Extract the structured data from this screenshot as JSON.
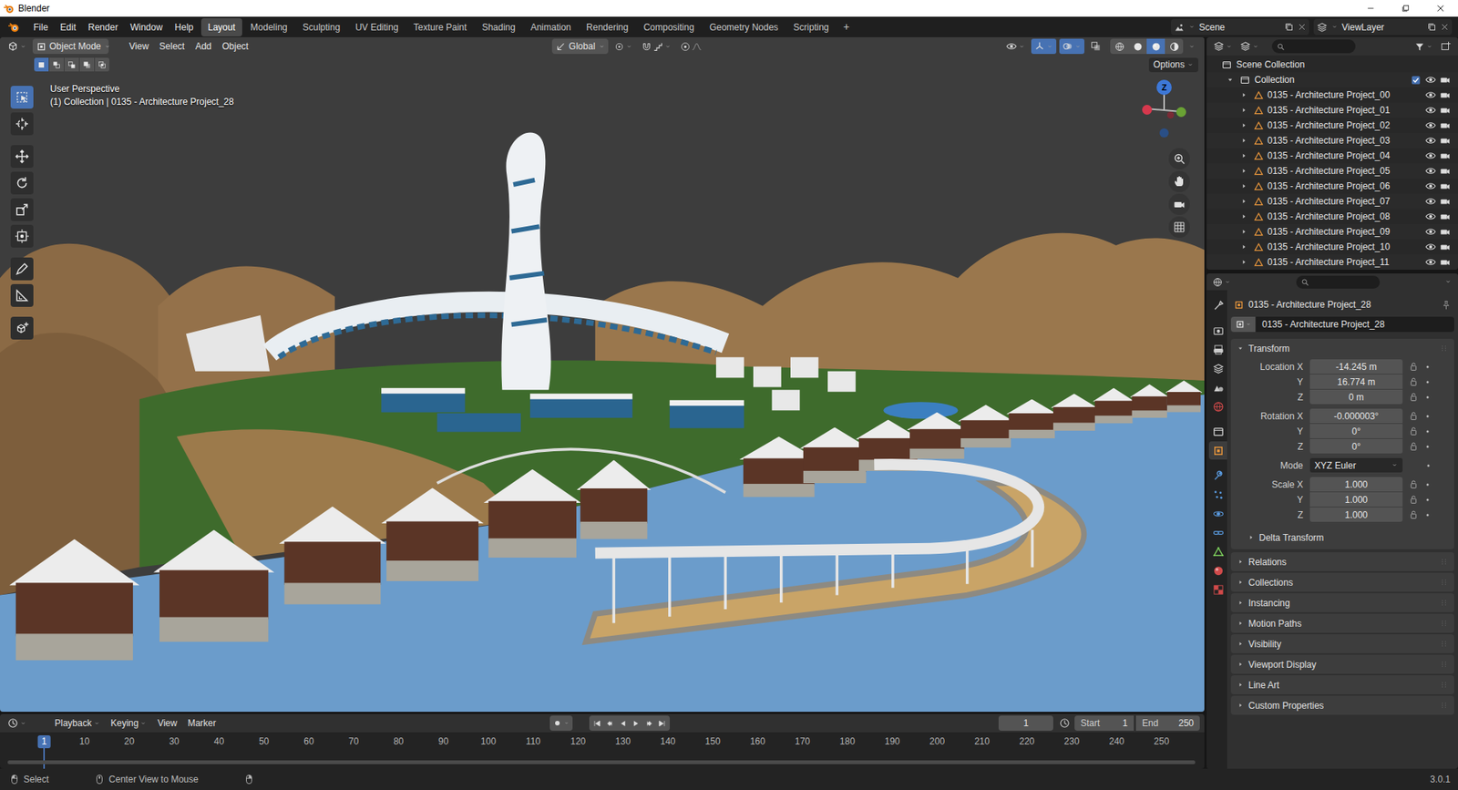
{
  "window": {
    "title": "Blender"
  },
  "topbar": {
    "menus": [
      "File",
      "Edit",
      "Render",
      "Window",
      "Help"
    ],
    "workspaces": [
      {
        "label": "Layout",
        "selected": true
      },
      {
        "label": "Modeling",
        "selected": false
      },
      {
        "label": "Sculpting",
        "selected": false
      },
      {
        "label": "UV Editing",
        "selected": false
      },
      {
        "label": "Texture Paint",
        "selected": false
      },
      {
        "label": "Shading",
        "selected": false
      },
      {
        "label": "Animation",
        "selected": false
      },
      {
        "label": "Rendering",
        "selected": false
      },
      {
        "label": "Compositing",
        "selected": false
      },
      {
        "label": "Geometry Nodes",
        "selected": false
      },
      {
        "label": "Scripting",
        "selected": false
      }
    ],
    "add_workspace": "+",
    "scene": "Scene",
    "view_layer": "ViewLayer"
  },
  "viewport": {
    "mode": "Object Mode",
    "menus": [
      "View",
      "Select",
      "Add",
      "Object"
    ],
    "orientation": "Global",
    "options": "Options",
    "view_name": "User Perspective",
    "active": "(1) Collection | 0135 - Architecture Project_28",
    "gizmo_label": "Z",
    "select_modes": [
      {
        "selected": true
      },
      {
        "selected": false
      },
      {
        "selected": false
      },
      {
        "selected": false
      },
      {
        "selected": false
      }
    ],
    "tools": [
      {
        "kind": "select",
        "selected": true
      },
      {
        "kind": "cursor",
        "selected": false
      },
      {
        "kind": "move",
        "selected": false
      },
      {
        "kind": "rotate",
        "selected": false
      },
      {
        "kind": "scale",
        "selected": false
      },
      {
        "kind": "transform",
        "selected": false
      },
      {
        "kind": "annotate",
        "selected": false
      },
      {
        "kind": "measure",
        "selected": false
      },
      {
        "kind": "addcube",
        "selected": false
      }
    ],
    "shading": [
      {
        "kind": "wire",
        "selected": false
      },
      {
        "kind": "solid",
        "selected": false
      },
      {
        "kind": "material",
        "selected": true
      },
      {
        "kind": "rendered",
        "selected": false
      }
    ]
  },
  "outliner": {
    "scene_collection": "Scene Collection",
    "collection": {
      "label": "Collection",
      "expanded": true,
      "checked": true,
      "visible": true,
      "renderable": true
    },
    "items": [
      {
        "label": "0135 - Architecture Project_00",
        "expanded": false,
        "visible": true,
        "renderable": true
      },
      {
        "label": "0135 - Architecture Project_01",
        "expanded": false,
        "visible": true,
        "renderable": true
      },
      {
        "label": "0135 - Architecture Project_02",
        "expanded": false,
        "visible": true,
        "renderable": true
      },
      {
        "label": "0135 - Architecture Project_03",
        "expanded": false,
        "visible": true,
        "renderable": true
      },
      {
        "label": "0135 - Architecture Project_04",
        "expanded": false,
        "visible": true,
        "renderable": true
      },
      {
        "label": "0135 - Architecture Project_05",
        "expanded": false,
        "visible": true,
        "renderable": true
      },
      {
        "label": "0135 - Architecture Project_06",
        "expanded": false,
        "visible": true,
        "renderable": true
      },
      {
        "label": "0135 - Architecture Project_07",
        "expanded": false,
        "visible": true,
        "renderable": true
      },
      {
        "label": "0135 - Architecture Project_08",
        "expanded": false,
        "visible": true,
        "renderable": true
      },
      {
        "label": "0135 - Architecture Project_09",
        "expanded": false,
        "visible": true,
        "renderable": true
      },
      {
        "label": "0135 - Architecture Project_10",
        "expanded": false,
        "visible": true,
        "renderable": true
      },
      {
        "label": "0135 - Architecture Project_11",
        "expanded": false,
        "visible": true,
        "renderable": true
      }
    ]
  },
  "properties": {
    "object": "0135 - Architecture Project_28",
    "name": "0135 - Architecture Project_28",
    "tabs": [
      {
        "kind": "tool",
        "selected": false
      },
      {
        "kind": "render",
        "selected": false
      },
      {
        "kind": "output",
        "selected": false
      },
      {
        "kind": "viewlayer",
        "selected": false
      },
      {
        "kind": "scene",
        "selected": false
      },
      {
        "kind": "world",
        "selected": false
      },
      {
        "kind": "collection",
        "selected": false
      },
      {
        "kind": "object",
        "selected": true
      },
      {
        "kind": "modifiers",
        "selected": false
      },
      {
        "kind": "particles",
        "selected": false
      },
      {
        "kind": "physics",
        "selected": false
      },
      {
        "kind": "constraints",
        "selected": false
      },
      {
        "kind": "data",
        "selected": false
      },
      {
        "kind": "material",
        "selected": false
      },
      {
        "kind": "texture",
        "selected": false
      }
    ],
    "transform": {
      "label": "Transform",
      "expanded": true,
      "groups": [
        {
          "kind": "fields",
          "rows": [
            {
              "label": "Location X",
              "value": "-14.245 m"
            },
            {
              "label": "Y",
              "value": "16.774 m"
            },
            {
              "label": "Z",
              "value": "0 m"
            }
          ]
        },
        {
          "kind": "fields",
          "rows": [
            {
              "label": "Rotation X",
              "value": "-0.000003°"
            },
            {
              "label": "Y",
              "value": "0°"
            },
            {
              "label": "Z",
              "value": "0°"
            }
          ]
        },
        {
          "kind": "dropdown",
          "rows": [
            {
              "label": "Mode",
              "value": "XYZ Euler"
            }
          ]
        },
        {
          "kind": "fields",
          "rows": [
            {
              "label": "Scale X",
              "value": "1.000"
            },
            {
              "label": "Y",
              "value": "1.000"
            },
            {
              "label": "Z",
              "value": "1.000"
            }
          ]
        }
      ],
      "subpanel": {
        "label": "Delta Transform",
        "expanded": false
      }
    },
    "panels": [
      {
        "label": "Relations",
        "expanded": false
      },
      {
        "label": "Collections",
        "expanded": false
      },
      {
        "label": "Instancing",
        "expanded": false
      },
      {
        "label": "Motion Paths",
        "expanded": false
      },
      {
        "label": "Visibility",
        "expanded": false
      },
      {
        "label": "Viewport Display",
        "expanded": false
      },
      {
        "label": "Line Art",
        "expanded": false
      },
      {
        "label": "Custom Properties",
        "expanded": false
      }
    ]
  },
  "timeline": {
    "menus": [
      "Playback",
      "Keying",
      "View",
      "Marker"
    ],
    "current_frame": "1",
    "start_label": "Start",
    "start": "1",
    "end_label": "End",
    "end": "250",
    "ruler": [
      {
        "label": "1",
        "selected": true
      },
      {
        "label": "10",
        "selected": false
      },
      {
        "label": "20",
        "selected": false
      },
      {
        "label": "30",
        "selected": false
      },
      {
        "label": "40",
        "selected": false
      },
      {
        "label": "50",
        "selected": false
      },
      {
        "label": "60",
        "selected": false
      },
      {
        "label": "70",
        "selected": false
      },
      {
        "label": "80",
        "selected": false
      },
      {
        "label": "90",
        "selected": false
      },
      {
        "label": "100",
        "selected": false
      },
      {
        "label": "110",
        "selected": false
      },
      {
        "label": "120",
        "selected": false
      },
      {
        "label": "130",
        "selected": false
      },
      {
        "label": "140",
        "selected": false
      },
      {
        "label": "150",
        "selected": false
      },
      {
        "label": "160",
        "selected": false
      },
      {
        "label": "170",
        "selected": false
      },
      {
        "label": "180",
        "selected": false
      },
      {
        "label": "190",
        "selected": false
      },
      {
        "label": "200",
        "selected": false
      },
      {
        "label": "210",
        "selected": false
      },
      {
        "label": "220",
        "selected": false
      },
      {
        "label": "230",
        "selected": false
      },
      {
        "label": "240",
        "selected": false
      },
      {
        "label": "250",
        "selected": false
      }
    ]
  },
  "status_bar": {
    "items": [
      "Select",
      "Center View to Mouse"
    ],
    "version": "3.0.1"
  }
}
